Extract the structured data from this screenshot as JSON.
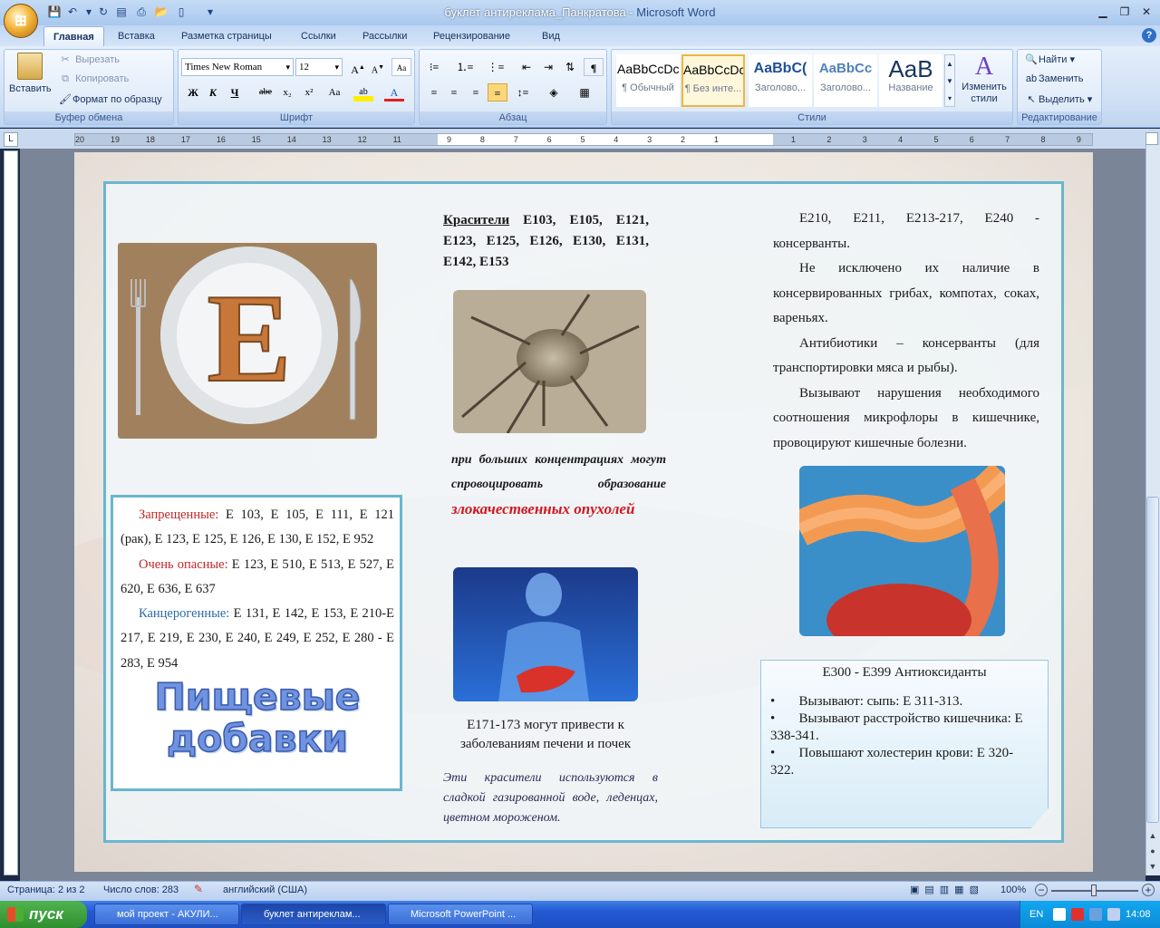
{
  "titlebar": {
    "doc": "буклет антиреклама_Панкратова",
    "app": "Microsoft Word",
    "separator": " - "
  },
  "tabs": [
    "Главная",
    "Вставка",
    "Разметка страницы",
    "Ссылки",
    "Рассылки",
    "Рецензирование",
    "Вид"
  ],
  "ribbon": {
    "clipboard": {
      "paste": "Вставить",
      "cut": "Вырезать",
      "copy": "Копировать",
      "format_painter": "Формат по образцу",
      "label": "Буфер обмена"
    },
    "font": {
      "name": "Times New Roman",
      "size": "12",
      "label": "Шрифт",
      "bold": "Ж",
      "italic": "К",
      "underline": "Ч",
      "strike": "abe",
      "sub": "x₂",
      "sup": "x²",
      "case": "Aa"
    },
    "paragraph": {
      "label": "Абзац",
      "pilcrow": "¶"
    },
    "styles": {
      "label": "Стили",
      "items": [
        {
          "sample": "AaBbCcDc",
          "name": "¶ Обычный"
        },
        {
          "sample": "AaBbCcDc",
          "name": "¶ Без инте..."
        },
        {
          "sample": "AaBbC(",
          "name": "Заголово..."
        },
        {
          "sample": "AaBbCc",
          "name": "Заголово..."
        },
        {
          "sample": "AaB",
          "name": "Название"
        }
      ],
      "change": "Изменить стили"
    },
    "editing": {
      "find": "Найти",
      "replace": "Заменить",
      "select": "Выделить",
      "label": "Редактирование"
    }
  },
  "ruler": {
    "left_ticks": [
      "20",
      "19",
      "18",
      "17",
      "16",
      "15",
      "14",
      "13",
      "12",
      "11"
    ],
    "mid_ticks": [
      "9",
      "8",
      "7",
      "6",
      "5",
      "4",
      "3",
      "2",
      "1"
    ],
    "right_ticks": [
      "1",
      "2",
      "3",
      "4",
      "5",
      "6",
      "7",
      "8",
      "9"
    ]
  },
  "document": {
    "col1": {
      "banned_label": "Запрещенные:",
      "banned_text": " Е 103, Е 105, Е 111, Е 121 (рак), Е 123, Е 125, Е 126, Е 130, Е 152, Е 952",
      "dangerous_label": "Очень опасные:",
      "dangerous_text": " Е 123, Е 510, Е 513, Е 527, Е 620, Е 636, Е 637",
      "carcinogenic_label": "Канцерогенные:",
      "carcinogenic_text": " Е 131, Е 142, Е 153, Е 210-Е 217, Е 219, Е 230, Е 240, Е 249, Е 252, Е 280 - Е 283, Е 954",
      "wordart_line1": "Пищевые",
      "wordart_line2": "добавки",
      "plate_letter": "E"
    },
    "col2": {
      "dyes_label": "Красители",
      "dyes_text": " Е103, Е105, Е121, Е123, Е125, Е126, Е130, Е131, Е142, Е153",
      "warning_lead": "при больших концентрациях могут спровоцировать образование ",
      "warning_red": "злокачественных опухолей",
      "liver_caption": "Е171-173 могут привести к заболеваниям печени и почек",
      "usage_note": "Эти красители используются в сладкой газированной воде, леденцах, цветном мороженом."
    },
    "col3": {
      "p1": "Е210, Е211, Е213-217, Е240 - консерванты.",
      "p2": "Не исключено их наличие в консервированных грибах, компотах, соках, вареньях.",
      "p3": "Антибиотики – консерванты (для транспортировки мяса и рыбы).",
      "p4": "Вызывают нарушения необходимого соотношения микрофлоры в кишечнике, провоцируют кишечные болезни.",
      "note_title": "Е300 - Е399 Антиоксиданты",
      "note_items": [
        "Вызывают: сыпь: Е 311-313.",
        "Вызывают расстройство кишечника: Е 338-341.",
        "Повышают холестерин крови: Е 320-322."
      ]
    }
  },
  "status": {
    "page": "Страница: 2 из 2",
    "words": "Число слов: 283",
    "lang": "английский (США)",
    "zoom": "100%"
  },
  "taskbar": {
    "start": "пуск",
    "tasks": [
      "мой проект - АКУЛИ...",
      "буклет антиреклам...",
      "Microsoft PowerPoint ..."
    ],
    "lang": "EN",
    "time": "14:08"
  },
  "colors": {
    "frame": "#69b6cf",
    "red_label": "#c0282a",
    "blue_label": "#2a6aa8",
    "warning_red": "#d01820"
  }
}
